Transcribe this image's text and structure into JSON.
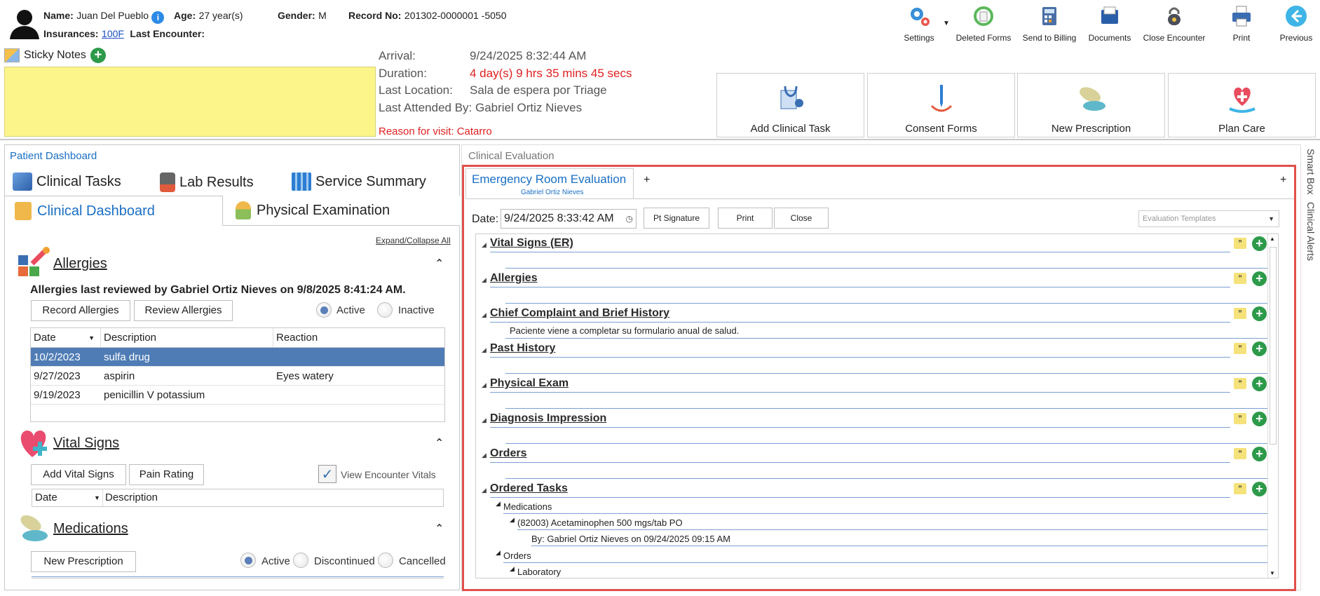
{
  "patient": {
    "name_label": "Name:",
    "name": "Juan Del Pueblo",
    "age_label": "Age:",
    "age": "27 year(s)",
    "gender_label": "Gender:",
    "gender": "M",
    "record_label": "Record No:",
    "record": "201302-0000001 -5050",
    "insurances_label": "Insurances:",
    "insurance": "100F",
    "last_encounter_label": "Last Encounter:"
  },
  "sticky_notes": {
    "label": "Sticky Notes"
  },
  "visit": {
    "arrival_label": "Arrival:",
    "arrival": "9/24/2025 8:32:44 AM",
    "duration_label": "Duration:",
    "duration": "4 day(s) 9 hrs 35 mins 45 secs",
    "location_label": "Last Location:",
    "location": "Sala de espera por Triage",
    "attended_label": "Last Attended By:",
    "attended": "Gabriel Ortiz Nieves",
    "reason": "Reason for visit: Catarro"
  },
  "toolbar": {
    "settings": "Settings",
    "deleted_forms": "Deleted Forms",
    "send_billing": "Send to Billing",
    "documents": "Documents",
    "close_encounter": "Close Encounter",
    "print": "Print",
    "previous": "Previous"
  },
  "actions": {
    "add_clinical_task": "Add Clinical Task",
    "consent_forms": "Consent Forms",
    "new_prescription": "New Prescription",
    "plan_care": "Plan Care"
  },
  "left": {
    "title": "Patient Dashboard",
    "tabs": [
      "Clinical Tasks",
      "Lab Results",
      "Service Summary",
      "Clinical Dashboard",
      "Physical Examination"
    ],
    "expand_all": "Expand/Collapse All",
    "allergies": {
      "title": "Allergies",
      "review_note": "Allergies last reviewed by Gabriel Ortiz Nieves on 9/8/2025 8:41:24 AM.",
      "record_btn": "Record Allergies",
      "review_btn": "Review Allergies",
      "active": "Active",
      "inactive": "Inactive",
      "columns": [
        "Date",
        "Description",
        "Reaction"
      ],
      "rows": [
        [
          "10/2/2023",
          "sulfa drug",
          ""
        ],
        [
          "9/27/2023",
          "aspirin",
          "Eyes watery"
        ],
        [
          "9/19/2023",
          "penicillin V potassium",
          ""
        ]
      ]
    },
    "vitals": {
      "title": "Vital Signs",
      "add_btn": "Add Vital Signs",
      "pain_btn": "Pain Rating",
      "view_encounter": "View Encounter Vitals",
      "columns": [
        "Date",
        "Description"
      ]
    },
    "medications": {
      "title": "Medications",
      "new_btn": "New Prescription",
      "active": "Active",
      "discontinued": "Discontinued",
      "cancelled": "Cancelled"
    }
  },
  "right": {
    "title": "Clinical Evaluation",
    "tab": "Emergency Room Evaluation",
    "tab_sub": "Gabriel Ortiz Nieves",
    "add_tab": "+",
    "date_label": "Date:",
    "date": "9/24/2025 8:33:42 AM",
    "pt_signature": "Pt Signature",
    "print": "Print",
    "close": "Close",
    "templates_placeholder": "Evaluation Templates",
    "sections": [
      {
        "title": "Vital Signs (ER)",
        "text": ""
      },
      {
        "title": "Allergies",
        "text": ""
      },
      {
        "title": "Chief Complaint and Brief History",
        "text": "Paciente viene a completar su formulario anual de salud."
      },
      {
        "title": "Past History",
        "text": ""
      },
      {
        "title": "Physical Exam",
        "text": ""
      },
      {
        "title": "Diagnosis Impression",
        "text": ""
      },
      {
        "title": "Orders",
        "text": ""
      },
      {
        "title": "Ordered Tasks",
        "text": ""
      }
    ],
    "tasks": {
      "medications": "Medications",
      "med_item": "(82003) Acetaminophen 500 mgs/tab PO",
      "med_by": "By: Gabriel Ortiz Nieves on 09/24/2025 09:15 AM",
      "orders": "Orders",
      "laboratory": "Laboratory"
    },
    "side_tabs": [
      "Smart Box",
      "Clinical Alerts"
    ]
  },
  "colors": {
    "accent": "#1a6fc4",
    "highlight_border": "#e0514b",
    "red_text": "#e02020",
    "sticky": "#fbf58a"
  }
}
